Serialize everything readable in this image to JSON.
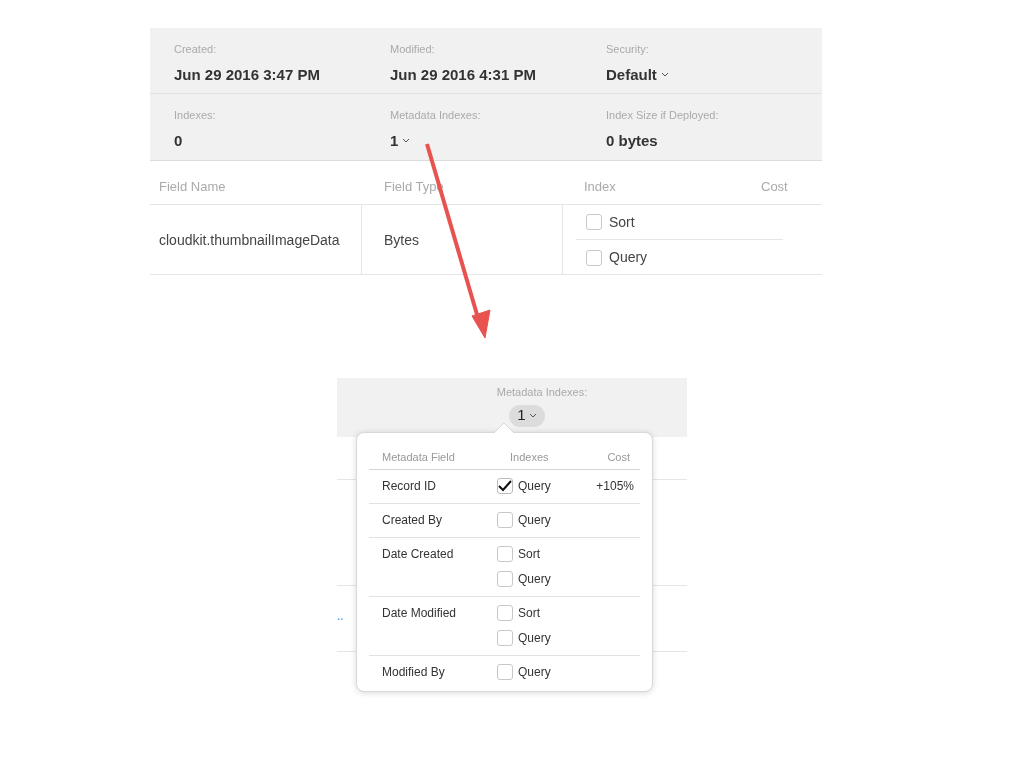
{
  "summary": [
    [
      {
        "label": "Created:",
        "value": "Jun 29 2016 3:47 PM",
        "dropdown": false
      },
      {
        "label": "Modified:",
        "value": "Jun 29 2016 4:31 PM",
        "dropdown": false
      },
      {
        "label": "Security:",
        "value": "Default",
        "dropdown": true
      }
    ],
    [
      {
        "label": "Indexes:",
        "value": "0",
        "dropdown": false
      },
      {
        "label": "Metadata Indexes:",
        "value": "1",
        "dropdown": true
      },
      {
        "label": "Index Size if Deployed:",
        "value": "0 bytes",
        "dropdown": false
      }
    ]
  ],
  "fields_table": {
    "columns": [
      "Field Name",
      "Field Type",
      "Index",
      "Cost"
    ],
    "rows": [
      {
        "name": "cloudkit.thumbnailImageData",
        "type": "Bytes",
        "indexes": [
          {
            "label": "Sort",
            "checked": false
          },
          {
            "label": "Query",
            "checked": false
          }
        ]
      }
    ]
  },
  "zoomed": {
    "label": "Metadata Indexes:",
    "value": "1",
    "link_fragment": "..",
    "popover": {
      "columns": [
        "Metadata Field",
        "Indexes",
        "Cost"
      ],
      "rows": [
        {
          "name": "Record ID",
          "indexes": [
            {
              "label": "Query",
              "checked": true
            }
          ],
          "cost": "+105%"
        },
        {
          "name": "Created By",
          "indexes": [
            {
              "label": "Query",
              "checked": false
            }
          ]
        },
        {
          "name": "Date Created",
          "indexes": [
            {
              "label": "Sort",
              "checked": false
            },
            {
              "label": "Query",
              "checked": false
            }
          ]
        },
        {
          "name": "Date Modified",
          "indexes": [
            {
              "label": "Sort",
              "checked": false
            },
            {
              "label": "Query",
              "checked": false
            }
          ]
        },
        {
          "name": "Modified By",
          "indexes": [
            {
              "label": "Query",
              "checked": false
            }
          ]
        }
      ]
    }
  }
}
